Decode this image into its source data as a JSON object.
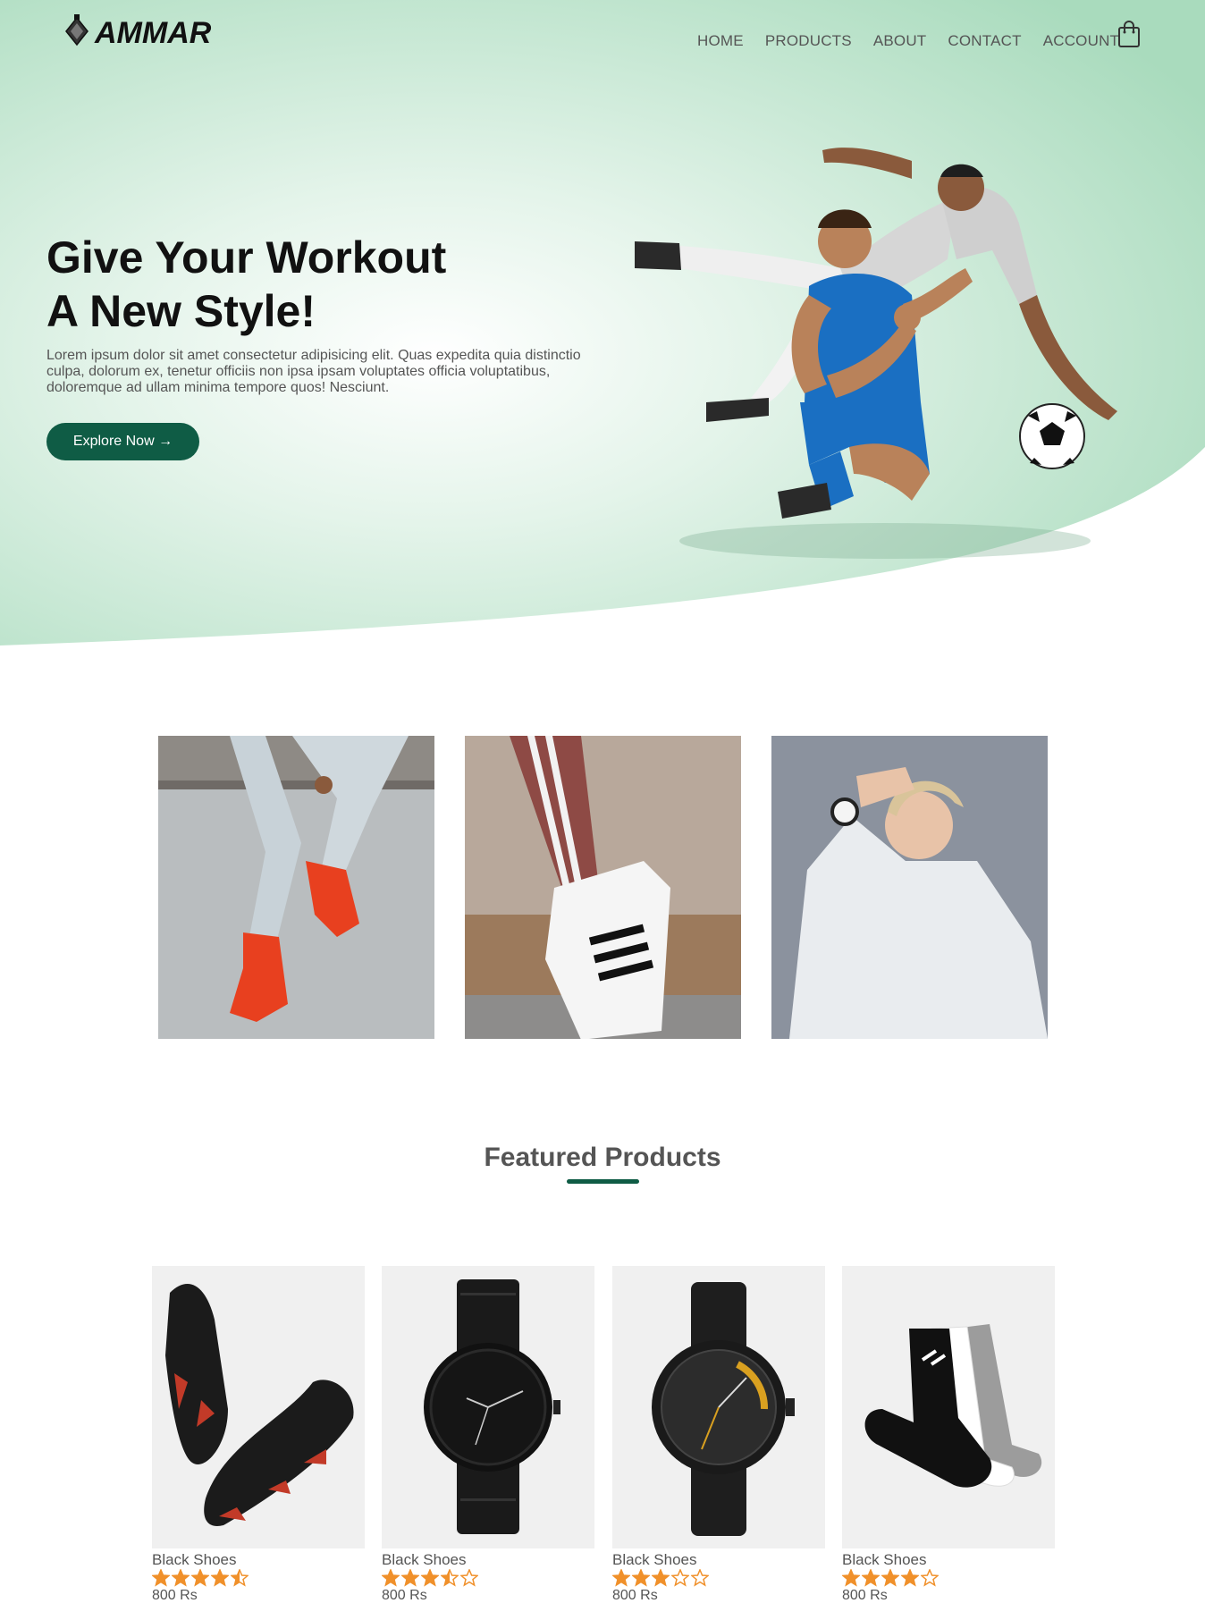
{
  "brand": {
    "logo_text": "AMMAR"
  },
  "nav": {
    "items": [
      {
        "label": "HOME"
      },
      {
        "label": "PRODUCTS"
      },
      {
        "label": "ABOUT"
      },
      {
        "label": "CONTACT"
      },
      {
        "label": "ACCOUNT"
      }
    ],
    "cart_icon": "shopping-bag-icon"
  },
  "hero": {
    "title_line1": "Give Your Workout",
    "title_line2": "A New Style!",
    "text": "Lorem ipsum dolor sit amet consectetur adipisicing elit. Quas expedita quia distinctio culpa, dolorum ex, tenetur officiis non ipsa ipsam voluptates officia voluptatibus, doloremque ad ullam minima tempore quos! Nesciunt.",
    "button_label": "Explore Now →"
  },
  "featured": {
    "title": "Featured Products",
    "products": [
      {
        "name": "Black Shoes",
        "rating": 4.5,
        "price": "800 Rs",
        "image": "shoes"
      },
      {
        "name": "Black Shoes",
        "rating": 3.5,
        "price": "800 Rs",
        "image": "watch-fossil"
      },
      {
        "name": "Black Shoes",
        "rating": 3,
        "price": "800 Rs",
        "image": "watch-roadster"
      },
      {
        "name": "Black Shoes",
        "rating": 4,
        "price": "800 Rs",
        "image": "socks"
      }
    ]
  },
  "colors": {
    "accent": "#0f5c45",
    "hero_bg": "#b7e0c7",
    "star": "#f0902a"
  }
}
